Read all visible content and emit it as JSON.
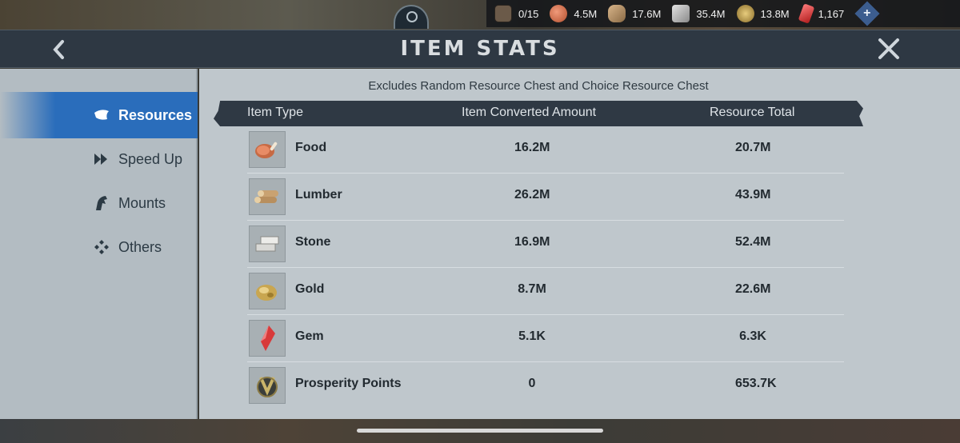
{
  "hud": {
    "resources": [
      {
        "icon": "hero-portrait-icon",
        "value": "0/15"
      },
      {
        "icon": "food-meat-icon",
        "value": "4.5M"
      },
      {
        "icon": "lumber-logs-icon",
        "value": "17.6M"
      },
      {
        "icon": "stone-blocks-icon",
        "value": "35.4M"
      },
      {
        "icon": "gold-nugget-icon",
        "value": "13.8M"
      },
      {
        "icon": "gem-crystal-icon",
        "value": "1,167"
      }
    ],
    "plus_icon": "plus-diamond-icon"
  },
  "header": {
    "title": "ITEM STATS",
    "back_icon": "chevron-left-icon",
    "close_icon": "close-icon"
  },
  "sidebar": {
    "items": [
      {
        "label": "Resources",
        "icon": "horn-icon",
        "active": true
      },
      {
        "label": "Speed Up",
        "icon": "fast-forward-icon",
        "active": false
      },
      {
        "label": "Mounts",
        "icon": "horse-head-icon",
        "active": false
      },
      {
        "label": "Others",
        "icon": "diamond-cluster-icon",
        "active": false
      }
    ]
  },
  "main": {
    "note": "Excludes Random Resource Chest and Choice Resource Chest",
    "columns": [
      "Item Type",
      "Item Converted Amount",
      "Resource Total"
    ],
    "rows": [
      {
        "name": "Food",
        "icon": "meat-icon",
        "converted": "16.2M",
        "total": "20.7M"
      },
      {
        "name": "Lumber",
        "icon": "logs-icon",
        "converted": "26.2M",
        "total": "43.9M"
      },
      {
        "name": "Stone",
        "icon": "stone-icon",
        "converted": "16.9M",
        "total": "52.4M"
      },
      {
        "name": "Gold",
        "icon": "gold-icon",
        "converted": "8.7M",
        "total": "22.6M"
      },
      {
        "name": "Gem",
        "icon": "gem-icon",
        "converted": "5.1K",
        "total": "6.3K"
      },
      {
        "name": "Prosperity Points",
        "icon": "prosperity-emblem-icon",
        "converted": "0",
        "total": "653.7K"
      }
    ]
  },
  "colors": {
    "header_bg": "#2e3843",
    "sidebar_active": "#2a6dbb",
    "panel_bg": "#bfc7cc"
  }
}
